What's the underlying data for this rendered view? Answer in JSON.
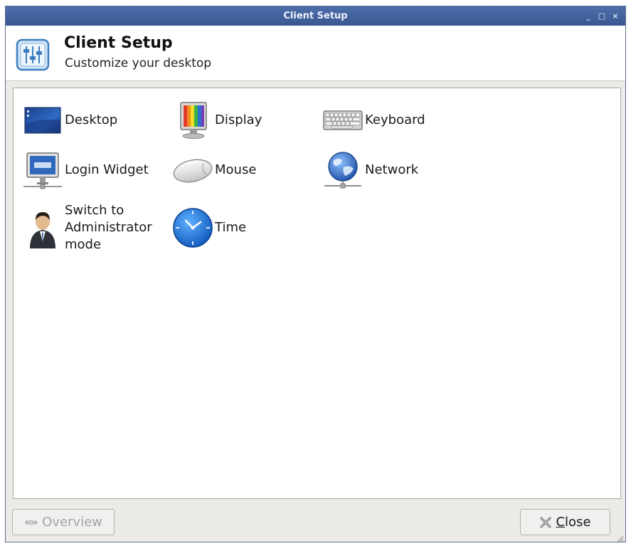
{
  "window": {
    "title": "Client Setup",
    "controls": {
      "minimize": "_",
      "maximize": "□",
      "close": "×"
    }
  },
  "header": {
    "title": "Client Setup",
    "subtitle": "Customize your desktop",
    "icon": "settings-sliders-icon"
  },
  "items": [
    {
      "label": "Desktop",
      "icon": "desktop-wallpaper-icon"
    },
    {
      "label": "Display",
      "icon": "display-monitor-icon"
    },
    {
      "label": "Keyboard",
      "icon": "keyboard-icon"
    },
    {
      "label": "Login Widget",
      "icon": "login-monitor-icon"
    },
    {
      "label": "Mouse",
      "icon": "mouse-icon"
    },
    {
      "label": "Network",
      "icon": "network-globe-icon"
    },
    {
      "label": "Switch to Administrator mode",
      "icon": "administrator-person-icon"
    },
    {
      "label": "Time",
      "icon": "clock-icon"
    }
  ],
  "buttons": {
    "overview": "Overview",
    "close": "Close"
  },
  "colors": {
    "titlebar": "#3e5c96",
    "window_bg": "#ecebe8",
    "content_bg": "#ffffff"
  }
}
